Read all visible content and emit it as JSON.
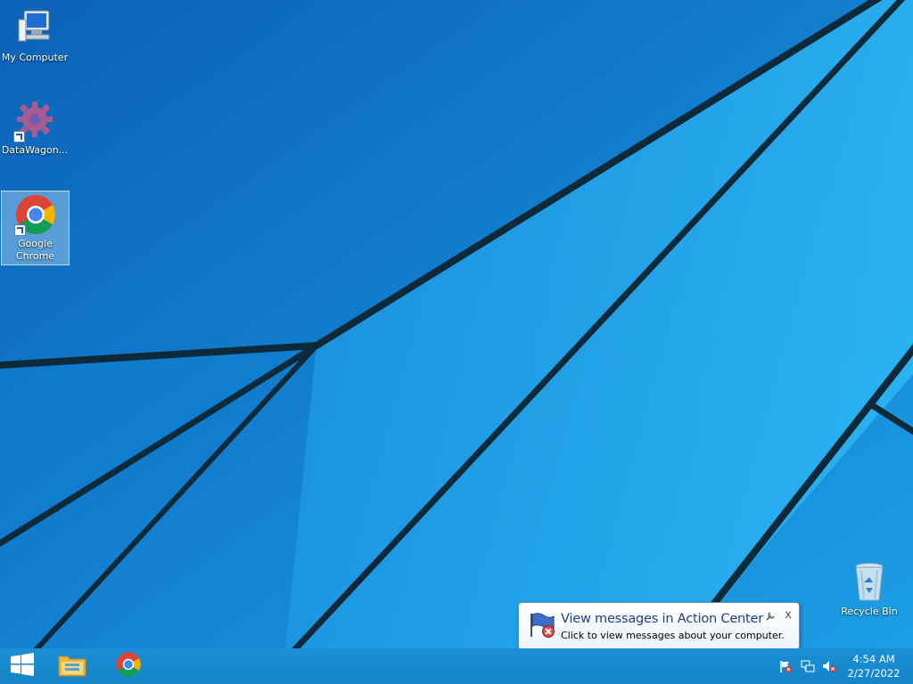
{
  "desktop": {
    "icons": [
      {
        "label": "My Computer",
        "icon": "computer-icon"
      },
      {
        "label": "DataWagon...",
        "icon": "gear-icon"
      },
      {
        "label": "Google Chrome",
        "icon": "chrome-icon",
        "selected": true
      },
      {
        "label": "Recycle Bin",
        "icon": "recycle-bin-icon"
      }
    ]
  },
  "taskbar": {
    "pinned": [
      {
        "name": "start",
        "icon": "windows-logo-icon"
      },
      {
        "name": "file-explorer",
        "icon": "folder-icon"
      },
      {
        "name": "chrome",
        "icon": "chrome-icon"
      }
    ],
    "tray_icons": [
      "action-center-flag-icon",
      "network-icon",
      "volume-muted-icon"
    ],
    "clock": {
      "time": "4:54 AM",
      "date": "2/27/2022"
    }
  },
  "notification": {
    "title": "View messages in Action Center",
    "body": "Click to view messages about your computer.",
    "icon": "action-center-flag-icon",
    "close_label": "x"
  },
  "colors": {
    "wallpaper_blue": "#1aa0ea",
    "taskbar": "#1584c8",
    "balloon_title": "#1e3f8a"
  }
}
